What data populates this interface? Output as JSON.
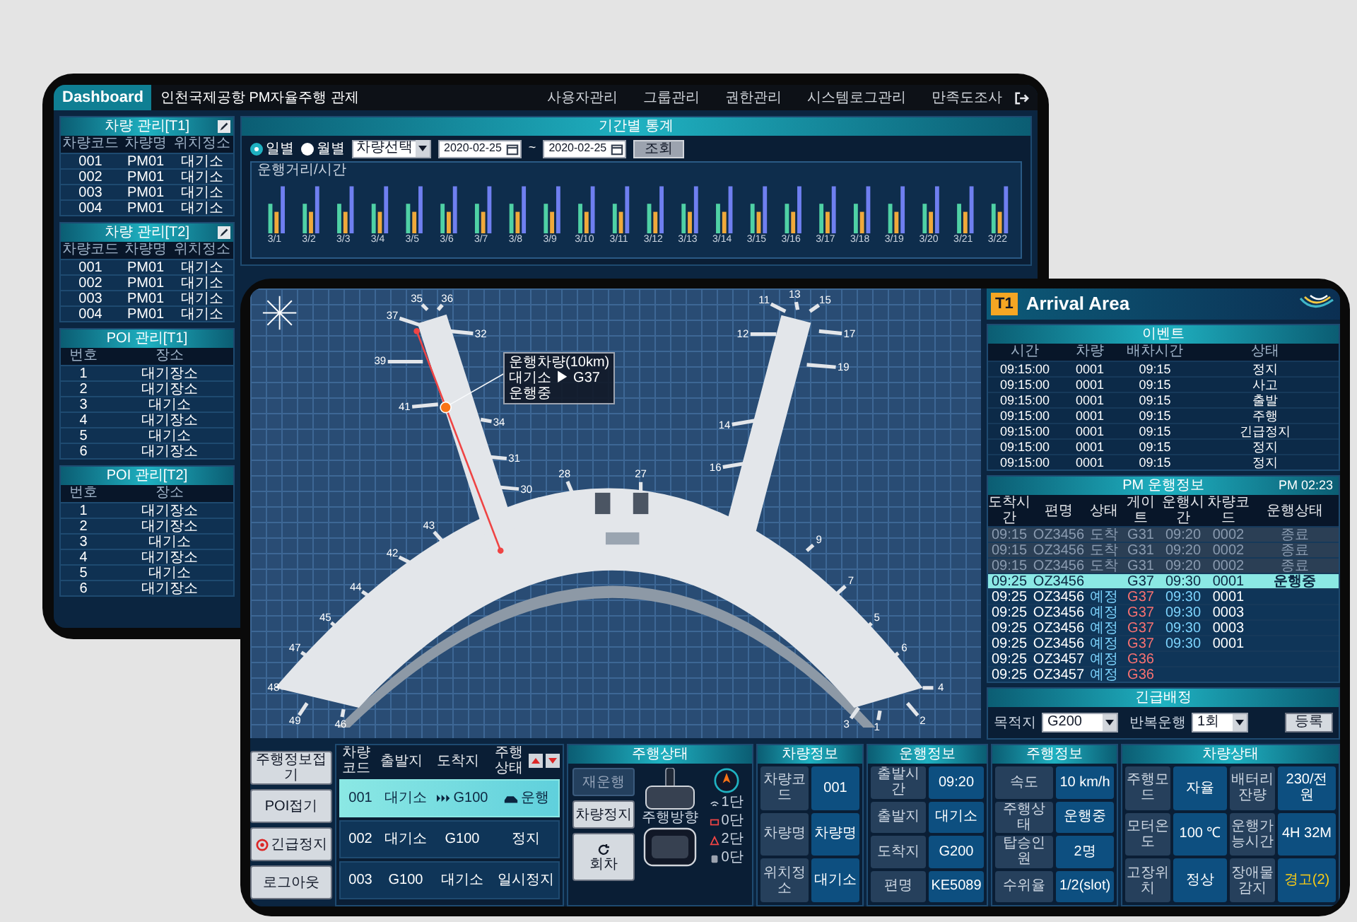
{
  "back_screen": {
    "brand": "Dashboard",
    "title": "인천국제공항 PM자율주행 관제",
    "nav": [
      "사용자관리",
      "그룹관리",
      "권한관리",
      "시스템로그관리",
      "만족도조사"
    ],
    "vehicle_tables": [
      {
        "title": "차량 관리[T1]",
        "editable": true,
        "columns": [
          "차량코드",
          "차량명",
          "위치정소"
        ],
        "rows": [
          [
            "001",
            "PM01",
            "대기소"
          ],
          [
            "002",
            "PM01",
            "대기소"
          ],
          [
            "003",
            "PM01",
            "대기소"
          ],
          [
            "004",
            "PM01",
            "대기소"
          ]
        ]
      },
      {
        "title": "차량 관리[T2]",
        "editable": true,
        "columns": [
          "차량코드",
          "차량명",
          "위치정소"
        ],
        "rows": [
          [
            "001",
            "PM01",
            "대기소"
          ],
          [
            "002",
            "PM01",
            "대기소"
          ],
          [
            "003",
            "PM01",
            "대기소"
          ],
          [
            "004",
            "PM01",
            "대기소"
          ]
        ]
      }
    ],
    "poi_tables": [
      {
        "title": "POI 관리[T1]",
        "editable": false,
        "columns": [
          "번호",
          "장소"
        ],
        "rows": [
          [
            "1",
            "대기장소"
          ],
          [
            "2",
            "대기장소"
          ],
          [
            "3",
            "대기소"
          ],
          [
            "4",
            "대기장소"
          ],
          [
            "5",
            "대기소"
          ],
          [
            "6",
            "대기장소"
          ]
        ]
      },
      {
        "title": "POI 관리[T2]",
        "editable": false,
        "columns": [
          "번호",
          "장소"
        ],
        "rows": [
          [
            "1",
            "대기장소"
          ],
          [
            "2",
            "대기장소"
          ],
          [
            "3",
            "대기소"
          ],
          [
            "4",
            "대기장소"
          ],
          [
            "5",
            "대기소"
          ],
          [
            "6",
            "대기장소"
          ]
        ]
      }
    ],
    "stats": {
      "title": "기간별 통계",
      "periods": [
        {
          "label": "일별",
          "selected": true
        },
        {
          "label": "월별",
          "selected": false
        }
      ],
      "vehicle_select": "차량선택",
      "date_from": "2020-02-25",
      "separator": "~",
      "date_to": "2020-02-25",
      "search_button": "조회",
      "chart_title": "운행거리/시간",
      "x_labels": [
        "3/1",
        "3/2",
        "3/3",
        "3/4",
        "3/5",
        "3/6",
        "3/7",
        "3/8",
        "3/9",
        "3/10",
        "3/11",
        "3/12",
        "3/13",
        "3/14",
        "3/15",
        "3/16",
        "3/17",
        "3/18",
        "3/19",
        "3/20",
        "3/21",
        "3/22"
      ]
    }
  },
  "front_screen": {
    "map": {
      "gates": [
        "37",
        "35",
        "36",
        "32",
        "39",
        "41",
        "34",
        "31",
        "30",
        "43",
        "42",
        "44",
        "45",
        "47",
        "48",
        "49",
        "46",
        "28",
        "27",
        "11",
        "13",
        "15",
        "12",
        "17",
        "19",
        "14",
        "16",
        "9",
        "7",
        "5",
        "6",
        "3",
        "1",
        "2",
        "4"
      ],
      "tooltip": [
        "운행차량(10km)",
        "대기소 ▶ G37",
        "운행중"
      ]
    },
    "area": {
      "terminal": "T1",
      "title": "Arrival Area"
    },
    "events": {
      "title": "이벤트",
      "columns": [
        "시간",
        "차량",
        "배차시간",
        "상태"
      ],
      "rows": [
        [
          "09:15:00",
          "0001",
          "09:15",
          "정지"
        ],
        [
          "09:15:00",
          "0001",
          "09:15",
          "사고"
        ],
        [
          "09:15:00",
          "0001",
          "09:15",
          "출발"
        ],
        [
          "09:15:00",
          "0001",
          "09:15",
          "주행"
        ],
        [
          "09:15:00",
          "0001",
          "09:15",
          "긴급정지"
        ],
        [
          "09:15:00",
          "0001",
          "09:15",
          "정지"
        ],
        [
          "09:15:00",
          "0001",
          "09:15",
          "정지"
        ]
      ]
    },
    "pm_info": {
      "title": "PM 운행정보",
      "clock": "PM 02:23",
      "columns": [
        "도착시간",
        "편명",
        "상태",
        "게이트",
        "운행시간",
        "차량코드",
        "운행상태"
      ],
      "rows": [
        {
          "cells": [
            "09:15",
            "OZ3456",
            "도착",
            "G31",
            "09:20",
            "0002",
            "종료"
          ],
          "kind": "ended",
          "selected": false
        },
        {
          "cells": [
            "09:15",
            "OZ3456",
            "도착",
            "G31",
            "09:20",
            "0002",
            "종료"
          ],
          "kind": "ended",
          "selected": false
        },
        {
          "cells": [
            "09:15",
            "OZ3456",
            "도착",
            "G31",
            "09:20",
            "0002",
            "종료"
          ],
          "kind": "ended",
          "selected": false
        },
        {
          "cells": [
            "09:25",
            "OZ3456",
            "",
            "G37",
            "09:30",
            "0001",
            "운행중"
          ],
          "kind": "running",
          "selected": true
        },
        {
          "cells": [
            "09:25",
            "OZ3456",
            "예정",
            "G37",
            "09:30",
            "0001",
            ""
          ],
          "kind": "scheduled",
          "selected": false
        },
        {
          "cells": [
            "09:25",
            "OZ3456",
            "예정",
            "G37",
            "09:30",
            "0003",
            ""
          ],
          "kind": "scheduled",
          "selected": false
        },
        {
          "cells": [
            "09:25",
            "OZ3456",
            "예정",
            "G37",
            "09:30",
            "0003",
            ""
          ],
          "kind": "scheduled",
          "selected": false
        },
        {
          "cells": [
            "09:25",
            "OZ3456",
            "예정",
            "G37",
            "09:30",
            "0001",
            ""
          ],
          "kind": "scheduled",
          "selected": false
        },
        {
          "cells": [
            "09:25",
            "OZ3457",
            "예정",
            "G36",
            "",
            "",
            ""
          ],
          "kind": "scheduled",
          "selected": false
        },
        {
          "cells": [
            "09:25",
            "OZ3457",
            "예정",
            "G36",
            "",
            "",
            ""
          ],
          "kind": "scheduled",
          "selected": false
        }
      ]
    },
    "emergency": {
      "title": "긴급배정",
      "destination_label": "목적지",
      "destination": "G200",
      "repeat_label": "반복운행",
      "repeat": "1회",
      "submit": "등록"
    },
    "side_buttons": [
      {
        "label": "주행정보접기",
        "kind": "plain"
      },
      {
        "label": "POI접기",
        "kind": "plain"
      },
      {
        "label": "긴급정지",
        "kind": "emergency"
      },
      {
        "label": "로그아웃",
        "kind": "plain"
      }
    ],
    "vehicle_list": {
      "columns": [
        "차량코드",
        "출발지",
        "도착지",
        "주행상태"
      ],
      "rows": [
        {
          "code": "001",
          "from": "대기소",
          "to": "G100",
          "status": "운행",
          "selected": true,
          "moving": true
        },
        {
          "code": "002",
          "from": "대기소",
          "to": "G100",
          "status": "정지",
          "selected": false,
          "moving": false
        },
        {
          "code": "003",
          "from": "G100",
          "to": "대기소",
          "status": "일시정지",
          "selected": false,
          "moving": false
        }
      ]
    },
    "drive_control": {
      "title": "주행상태",
      "buttons": [
        {
          "label": "재운행",
          "kind": "plain",
          "disabled": true
        },
        {
          "label": "차량정지",
          "kind": "plain",
          "disabled": false
        },
        {
          "label": "회차",
          "kind": "return",
          "disabled": false
        }
      ],
      "direction_label": "주행방향",
      "legend": [
        {
          "kind": "signal",
          "text": "1단"
        },
        {
          "kind": "box",
          "text": "0단"
        },
        {
          "kind": "warning",
          "text": "2단"
        },
        {
          "kind": "bus",
          "text": "0단"
        }
      ]
    },
    "vehicle_info": {
      "title": "차량정보",
      "fields": [
        {
          "label": "차량코드",
          "value": "001"
        },
        {
          "label": "차량명",
          "value": "차량명"
        },
        {
          "label": "위치정소",
          "value": "대기소"
        }
      ]
    },
    "operation_info": {
      "title": "운행정보",
      "fields": [
        {
          "label": "출발시간",
          "value": "09:20"
        },
        {
          "label": "출발지",
          "value": "대기소"
        },
        {
          "label": "도착지",
          "value": "G200"
        },
        {
          "label": "편명",
          "value": "KE5089"
        }
      ]
    },
    "drive_info": {
      "title": "주행정보",
      "fields": [
        {
          "label": "속도",
          "value": "10 km/h"
        },
        {
          "label": "주행상태",
          "value": "운행중"
        },
        {
          "label": "탑승인원",
          "value": "2명"
        },
        {
          "label": "수위율",
          "value": "1/2(slot)"
        }
      ]
    },
    "vehicle_status": {
      "title": "차량상태",
      "fields": [
        {
          "label": "주행모드",
          "value": "자율",
          "alert": false
        },
        {
          "label": "배터리잔량",
          "value": "230/전원",
          "alert": false
        },
        {
          "label": "모터온도",
          "value": "100 ℃",
          "alert": false
        },
        {
          "label": "운행가능시간",
          "value": "4H 32M",
          "alert": false
        },
        {
          "label": "고장위치",
          "value": "정상",
          "alert": false
        },
        {
          "label": "장애물감지",
          "value": "경고(2)",
          "alert": true
        }
      ]
    }
  }
}
